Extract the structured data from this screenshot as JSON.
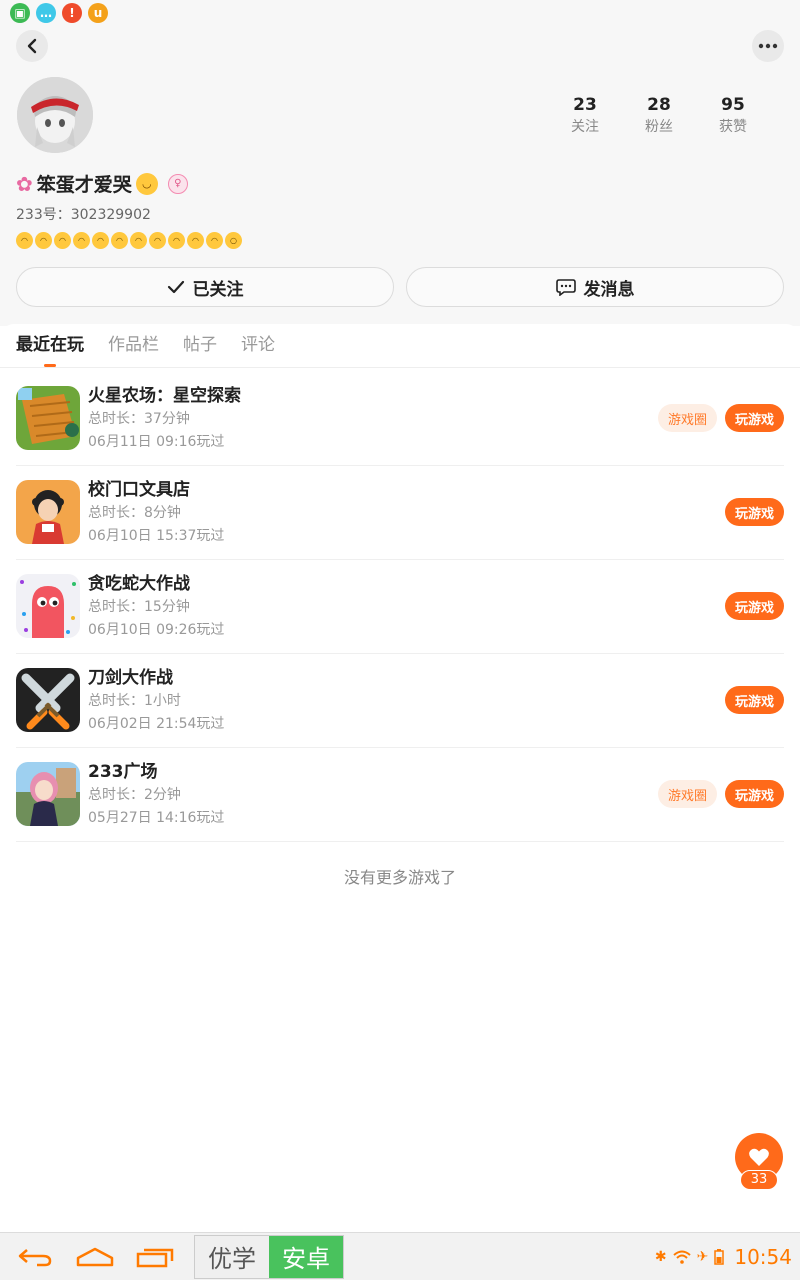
{
  "profile": {
    "nickname": "笨蛋才爱哭",
    "user_id": "233号：302329902",
    "stats": [
      {
        "num": "23",
        "label": "关注"
      },
      {
        "num": "28",
        "label": "粉丝"
      },
      {
        "num": "95",
        "label": "获赞"
      }
    ],
    "follow_label": "已关注",
    "message_label": "发消息"
  },
  "tabs": [
    "最近在玩",
    "作品栏",
    "帖子",
    "评论"
  ],
  "games": [
    {
      "name": "火星农场：星空探索",
      "duration": "总时长：37分钟",
      "last_played": "06月11日 09:16玩过",
      "has_circle": true
    },
    {
      "name": "校门口文具店",
      "duration": "总时长：8分钟",
      "last_played": "06月10日 15:37玩过",
      "has_circle": false
    },
    {
      "name": "贪吃蛇大作战",
      "duration": "总时长：15分钟",
      "last_played": "06月10日 09:26玩过",
      "has_circle": false
    },
    {
      "name": "刀剑大作战",
      "duration": "总时长：1小时",
      "last_played": "06月02日 21:54玩过",
      "has_circle": false
    },
    {
      "name": "233广场",
      "duration": "总时长：2分钟",
      "last_played": "05月27日 14:16玩过",
      "has_circle": true
    }
  ],
  "buttons": {
    "circle": "游戏圈",
    "play": "玩游戏"
  },
  "no_more": "没有更多游戏了",
  "like_count": "33",
  "system": {
    "ime_left": "优学",
    "ime_right": "安卓",
    "time": "10:54"
  },
  "colors": {
    "accent": "#ff6a1a",
    "accent_light": "#fdeee4"
  }
}
